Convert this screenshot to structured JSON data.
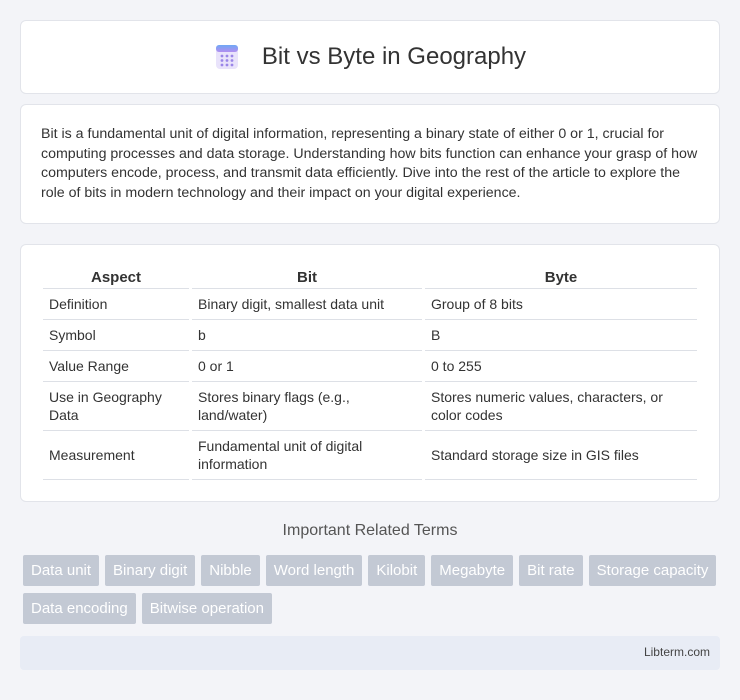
{
  "header": {
    "title": "Bit vs Byte in Geography",
    "icon": "calculator-icon"
  },
  "intro": "Bit is a fundamental unit of digital information, representing a binary state of either 0 or 1, crucial for computing processes and data storage. Understanding how bits function can enhance your grasp of how computers encode, process, and transmit data efficiently. Dive into the rest of the article to explore the role of bits in modern technology and their impact on your digital experience.",
  "table": {
    "headers": [
      "Aspect",
      "Bit",
      "Byte"
    ],
    "rows": [
      [
        "Definition",
        "Binary digit, smallest data unit",
        "Group of 8 bits"
      ],
      [
        "Symbol",
        "b",
        "B"
      ],
      [
        "Value Range",
        "0 or 1",
        "0 to 255"
      ],
      [
        "Use in Geography Data",
        "Stores binary flags (e.g., land/water)",
        "Stores numeric values, characters, or color codes"
      ],
      [
        "Measurement",
        "Fundamental unit of digital information",
        "Standard storage size in GIS files"
      ]
    ]
  },
  "related": {
    "title": "Important Related Terms",
    "tags": [
      "Data unit",
      "Binary digit",
      "Nibble",
      "Word length",
      "Kilobit",
      "Megabyte",
      "Bit rate",
      "Storage capacity",
      "Data encoding",
      "Bitwise operation"
    ]
  },
  "footer": {
    "site": "Libterm.com"
  },
  "colors": {
    "background": "#f3f4f8",
    "tag_bg": "#c3c9d4",
    "footer_bg": "#e8ecf5"
  }
}
